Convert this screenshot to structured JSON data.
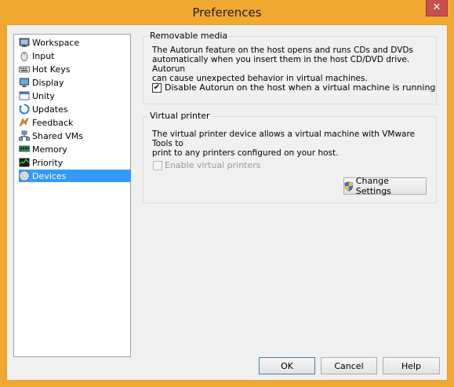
{
  "window": {
    "title": "Preferences",
    "close_glyph": "✕"
  },
  "sidebar": {
    "items": [
      {
        "label": "Workspace",
        "icon": "workspace-icon",
        "selected": false
      },
      {
        "label": "Input",
        "icon": "mouse-icon",
        "selected": false
      },
      {
        "label": "Hot Keys",
        "icon": "keyboard-icon",
        "selected": false
      },
      {
        "label": "Display",
        "icon": "monitor-icon",
        "selected": false
      },
      {
        "label": "Unity",
        "icon": "unity-icon",
        "selected": false
      },
      {
        "label": "Updates",
        "icon": "refresh-icon",
        "selected": false
      },
      {
        "label": "Feedback",
        "icon": "feedback-icon",
        "selected": false
      },
      {
        "label": "Shared VMs",
        "icon": "network-icon",
        "selected": false
      },
      {
        "label": "Memory",
        "icon": "memory-icon",
        "selected": false
      },
      {
        "label": "Priority",
        "icon": "priority-icon",
        "selected": false
      },
      {
        "label": "Devices",
        "icon": "disc-icon",
        "selected": true
      }
    ]
  },
  "removable_media": {
    "title": "Removable media",
    "description_lines": [
      "The Autorun feature on the host opens and runs CDs and DVDs",
      "automatically when you insert them in the host CD/DVD drive. Autorun",
      "can cause unexpected behavior in virtual machines."
    ],
    "checkbox_label": "Disable Autorun on the host when a virtual machine is running",
    "checkbox_checked": true
  },
  "virtual_printer": {
    "title": "Virtual printer",
    "description_lines": [
      "The virtual printer device allows a virtual machine with VMware Tools to",
      "print to any printers configured on your host."
    ],
    "checkbox_label": "Enable virtual printers",
    "checkbox_checked": false,
    "checkbox_enabled": false,
    "change_settings_label": "Change Settings"
  },
  "footer": {
    "ok_label": "OK",
    "cancel_label": "Cancel",
    "help_label": "Help"
  },
  "colors": {
    "frame": "#f0a830",
    "selection": "#3399ff",
    "close": "#c7504a"
  }
}
